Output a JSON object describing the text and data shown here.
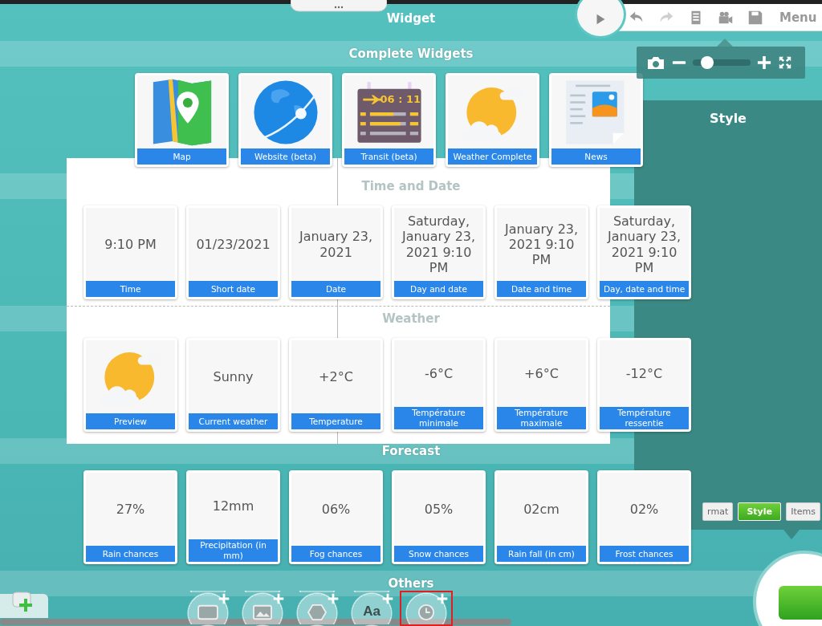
{
  "title": "Widget",
  "toolbar": {
    "buttons": [
      {
        "kind": "undo",
        "disabled": false
      },
      {
        "kind": "redo",
        "disabled": true
      },
      {
        "kind": "list",
        "disabled": false
      },
      {
        "kind": "video",
        "disabled": false
      },
      {
        "kind": "save",
        "disabled": false
      }
    ],
    "menu": "Menu"
  },
  "zoom": {
    "level": 0.16
  },
  "style_panel": {
    "title": "Style",
    "tabs": [
      {
        "label": "rmat",
        "selected": false
      },
      {
        "label": "Style",
        "selected": true
      },
      {
        "label": "Items",
        "selected": false
      }
    ]
  },
  "sections": [
    {
      "title": "Complete Widgets",
      "cards": [
        {
          "kind": "map",
          "label": "Map"
        },
        {
          "kind": "globe",
          "label": "Website (beta)"
        },
        {
          "kind": "board",
          "label": "Transit (beta)",
          "caption": "06 : 11"
        },
        {
          "kind": "weather",
          "label": "Weather Complete"
        },
        {
          "kind": "news",
          "label": "News"
        }
      ]
    },
    {
      "title": "Time and Date",
      "cards": [
        {
          "kind": "text",
          "value": "9:10 PM",
          "label": "Time"
        },
        {
          "kind": "text",
          "value": "01/23/2021",
          "label": "Short date"
        },
        {
          "kind": "text",
          "value": "January 23, 2021",
          "label": "Date"
        },
        {
          "kind": "text",
          "value": "Saturday, January 23, 2021 9:10 PM",
          "label": "Day and date"
        },
        {
          "kind": "text",
          "value": "January 23, 2021 9:10 PM",
          "label": "Date and time"
        },
        {
          "kind": "text",
          "value": "Saturday, January 23, 2021 9:10 PM",
          "label": "Day, date and time"
        }
      ]
    },
    {
      "title": "Weather",
      "cards": [
        {
          "kind": "weather",
          "label": "Preview"
        },
        {
          "kind": "text",
          "value": "Sunny",
          "label": "Current weather"
        },
        {
          "kind": "text",
          "value": "+2°C",
          "label": "Temperature"
        },
        {
          "kind": "text",
          "value": "-6°C",
          "label": "Température minimale"
        },
        {
          "kind": "text",
          "value": "+6°C",
          "label": "Température maximale"
        },
        {
          "kind": "text",
          "value": "-12°C",
          "label": "Température ressentie"
        }
      ]
    },
    {
      "title": "Forecast",
      "cards": [
        {
          "kind": "text",
          "value": "27%",
          "label": "Rain chances"
        },
        {
          "kind": "text",
          "value": "12mm",
          "label": "Precipitation (in mm)"
        },
        {
          "kind": "text",
          "value": "06%",
          "label": "Fog chances"
        },
        {
          "kind": "text",
          "value": "05%",
          "label": "Snow chances"
        },
        {
          "kind": "text",
          "value": "02cm",
          "label": "Rain fall (in cm)"
        },
        {
          "kind": "text",
          "value": "02%",
          "label": "Frost chances"
        }
      ]
    },
    {
      "title": "Others"
    }
  ],
  "tools": [
    {
      "kind": "screen",
      "highlighted": false
    },
    {
      "kind": "image",
      "highlighted": false
    },
    {
      "kind": "shape",
      "highlighted": false
    },
    {
      "kind": "text",
      "label": "Aa",
      "highlighted": false
    },
    {
      "kind": "clock",
      "highlighted": true
    }
  ]
}
